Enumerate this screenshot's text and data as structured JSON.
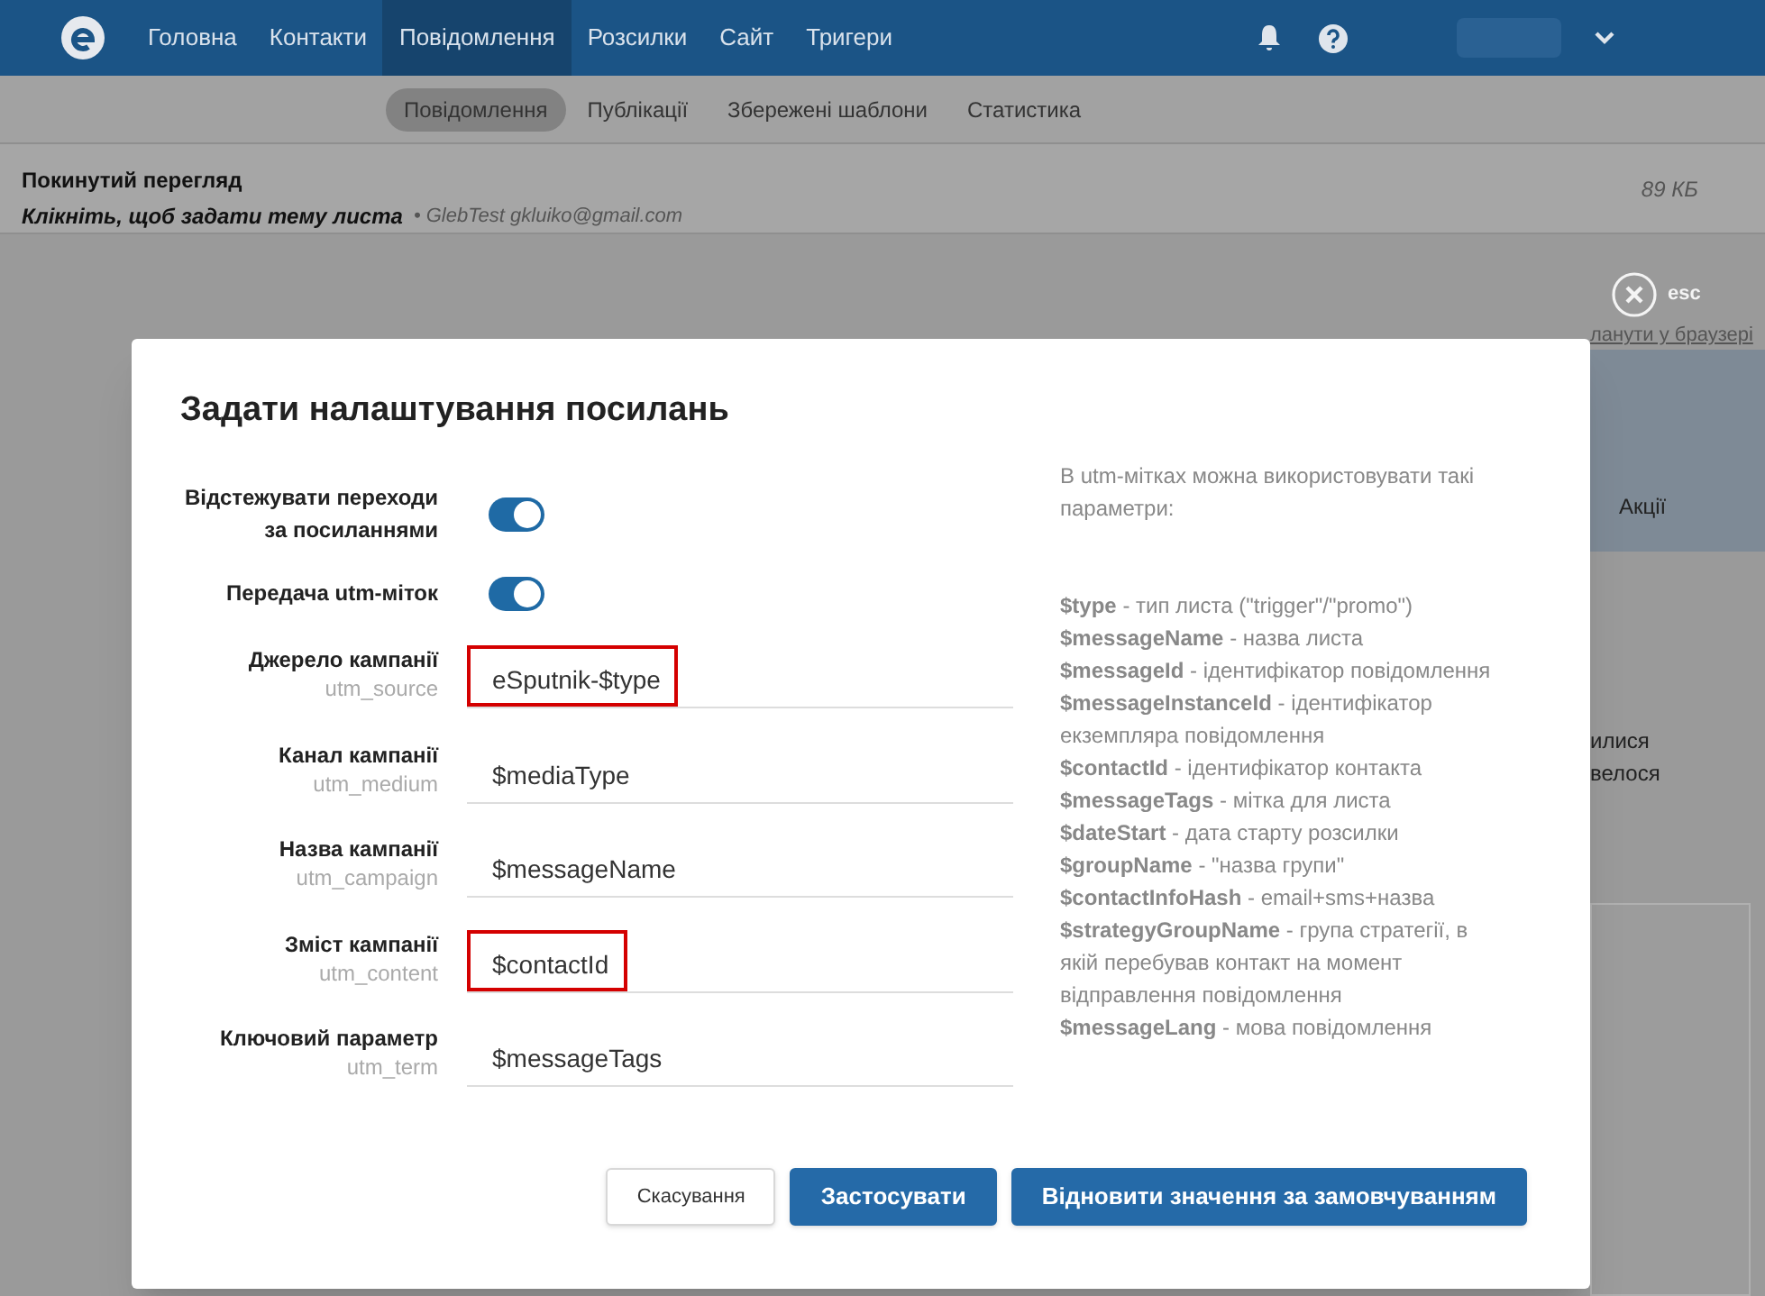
{
  "nav": {
    "items": [
      {
        "label": "Головна",
        "selected": false
      },
      {
        "label": "Контакти",
        "selected": false
      },
      {
        "label": "Повідомлення",
        "selected": true
      },
      {
        "label": "Розсилки",
        "selected": false
      },
      {
        "label": "Сайт",
        "selected": false
      },
      {
        "label": "Тригери",
        "selected": false
      }
    ]
  },
  "subnav": {
    "tabs": [
      {
        "label": "Повідомлення",
        "selected": true
      },
      {
        "label": "Публікації",
        "selected": false
      },
      {
        "label": "Збережені шаблони",
        "selected": false
      },
      {
        "label": "Статистика",
        "selected": false
      }
    ]
  },
  "message": {
    "title": "Покинутий перегляд",
    "subject": "Клікніть, щоб задати тему листа",
    "sender": "• GlebTest gkluiko@gmail.com",
    "size": "89 КБ"
  },
  "background": {
    "close_label": "esc",
    "link": "ланути у браузері",
    "banner": "Акції",
    "text_lines": [
      "илися",
      "велося"
    ]
  },
  "dialog": {
    "title": "Задати налаштування посилань",
    "toggles": [
      {
        "label": "Відстежувати переходи за посиланнями",
        "on": true
      },
      {
        "label": "Передача utm-міток",
        "on": true
      }
    ],
    "fields": [
      {
        "label": "Джерело кампанії",
        "param": "utm_source",
        "value": "eSputnik-$type",
        "highlighted": true
      },
      {
        "label": "Канал кампанії",
        "param": "utm_medium",
        "value": "$mediaType",
        "highlighted": false
      },
      {
        "label": "Назва кампанії",
        "param": "utm_campaign",
        "value": "$messageName",
        "highlighted": false
      },
      {
        "label": "Зміст кампанії",
        "param": "utm_content",
        "value": "$contactId",
        "highlighted": true
      },
      {
        "label": "Ключовий параметр",
        "param": "utm_term",
        "value": "$messageTags",
        "highlighted": false
      }
    ],
    "help": {
      "intro": "В utm-мітках можна використовувати такі параметри:",
      "items": [
        "**$type** - тип листа (\"trigger\"/\"promo\")",
        "**$messageName** - назва листа",
        "**$messageId** - ідентифікатор повідомлення",
        "**$messageInstanceId** - ідентифікатор екземпляра повідомлення",
        "**$contactId** - ідентифікатор контакта",
        "**$messageTags** - мітка для листа",
        "**$dateStart** - дата старту розсилки",
        "**$groupName** - \"назва групи\"",
        "**$contactInfoHash** - email+sms+назва",
        "**$strategyGroupName** - група стратегії, в якій перебував контакт на момент відправлення повідомлення",
        "**$messageLang** - мова повідомлення"
      ]
    },
    "buttons": [
      {
        "label": "Скасування",
        "kind": "secondary"
      },
      {
        "label": "Застосувати",
        "kind": "primary"
      },
      {
        "label": "Відновити значення за замовчуванням",
        "kind": "primary"
      }
    ]
  }
}
